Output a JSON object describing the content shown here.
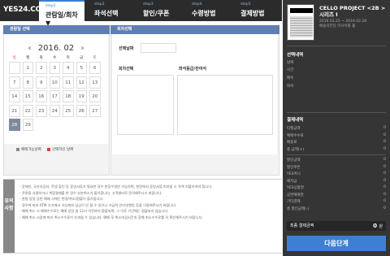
{
  "header": {
    "logo": "YES24.COM",
    "steps": [
      {
        "num": "step1",
        "label": "관람일/회차 ▼"
      },
      {
        "num": "step2",
        "label": "좌석선택"
      },
      {
        "num": "step3",
        "label": "할인/쿠폰"
      },
      {
        "num": "step4",
        "label": "수령방법"
      },
      {
        "num": "step5",
        "label": "결제방법"
      }
    ]
  },
  "left": {
    "tab_label": "관람일 선택",
    "month": "2016. 02",
    "prev": "‹",
    "next": "›",
    "weekdays": [
      "일",
      "월",
      "화",
      "수",
      "목",
      "금",
      "토"
    ],
    "days": [
      "",
      "1",
      "2",
      "3",
      "4",
      "5",
      "6",
      "7",
      "8",
      "9",
      "10",
      "11",
      "12",
      "13",
      "14",
      "15",
      "16",
      "17",
      "18",
      "19",
      "20",
      "21",
      "22",
      "23",
      "24",
      "25",
      "26",
      "27",
      "28",
      "29"
    ],
    "selected_day": "28",
    "legend_available": "예매가능날짜",
    "legend_selected": "선택하신 날짜",
    "legend_available_color": "#888888",
    "legend_selected_color": "#d94040"
  },
  "right": {
    "tab_label": "회차선택",
    "selected_date_label": "선택날짜",
    "session_label": "회차선택",
    "seat_label": "좌석등급/잔여석"
  },
  "notice": {
    "side_label": "유의사항",
    "items": [
      "- 장애인, 국가유공자, 학생 할인 등 증빙서류가 필요한 경우 현장수령만 가능하며, 현장에서 증빙서류 미지참 시 차액 지불하셔야 합니다.",
      "- 쿠폰을 사용하거나 복합결제를 한 경우 부분취소가 불가합니다. 고객센터로 문의해주시기 바랍니다.",
      "- 관람 당일 공연 예매 시에는 변경/취소/환불이 불가합니다.",
      "- 경우에 따라 ATM 기기에서 가상계좌 입금이 안 될 수 있으니 가급적 인터넷뱅킹 등을 이용해주시기 바랍니다.",
      "- 예매 취소 시 예매수수료는 예매 당일 밤 12시 이전까지 환불되며, 그 이후 기간에는 환불되지 않습니다.",
      "- 예매 취소 시점에 따라 취소수수료가 부과될 수 있습니다. 예매 후 취소마감시간과 함께 취소수수료를 꼭 확인해주시기 바랍니다."
    ]
  },
  "sidebar": {
    "title": "CELLO PROJECT <2B > 시리즈 I",
    "date": "2016.02.25 ~ 2016.02.28",
    "venue": "예술의전당 리사이틀 홀",
    "booking_title": "선택내역",
    "booking_rows": [
      "날짜",
      "시간",
      "매수",
      "좌석"
    ],
    "payment_title": "결제내역",
    "payment_rows": [
      {
        "label": "티켓금액",
        "value": "0"
      },
      {
        "label": "예매수수료",
        "value": "0"
      },
      {
        "label": "배송료",
        "value": "0"
      },
      {
        "label": "총 금액(+)",
        "value": "0"
      }
    ],
    "discount_rows": [
      {
        "label": "할인금액",
        "value": "0"
      },
      {
        "label": "할인쿠폰",
        "value": "0"
      },
      {
        "label": "YES머니",
        "value": "0"
      },
      {
        "label": "예치금",
        "value": "0"
      },
      {
        "label": "YES상품권",
        "value": "0"
      },
      {
        "label": "공연예매권",
        "value": "0"
      },
      {
        "label": "기타결제",
        "value": "0"
      },
      {
        "label": "총 할인금액(-)",
        "value": "0"
      }
    ],
    "total_label": "최종 결제금액",
    "total_value": "0",
    "total_unit": "원",
    "next_button": "다음단계"
  }
}
